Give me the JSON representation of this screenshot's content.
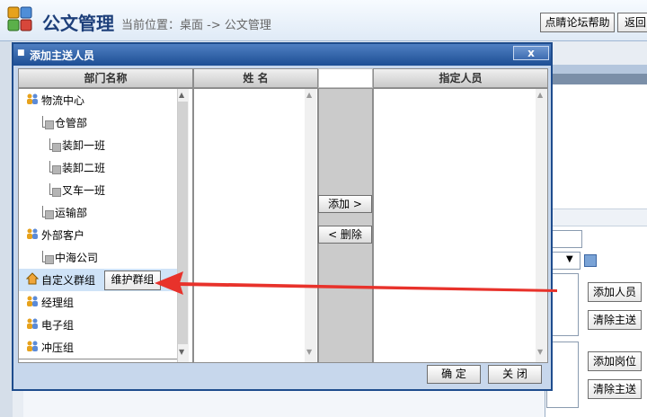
{
  "header": {
    "app_title": "公文管理",
    "breadcrumb": "当前位置：桌面 -> 公文管理",
    "forum_help_label": "点睛论坛帮助",
    "back_label": "返回"
  },
  "side_buttons": {
    "add_person": "添加人员",
    "clear_send_1": "清除主送",
    "add_position": "添加岗位",
    "clear_send_2": "清除主送"
  },
  "dialog": {
    "title": "添加主送人员",
    "close_label": "x",
    "columns": {
      "dept": "部门名称",
      "name": "姓  名",
      "assign": "指定人员"
    },
    "departments": [
      {
        "label": "物流中心",
        "icon": "people-icon",
        "indent": 0
      },
      {
        "label": "仓管部",
        "icon": "tree-node-icon",
        "indent": 1
      },
      {
        "label": "装卸一班",
        "icon": "tree-node-icon",
        "indent": 2
      },
      {
        "label": "装卸二班",
        "icon": "tree-node-icon",
        "indent": 2
      },
      {
        "label": "叉车一班",
        "icon": "tree-node-icon",
        "indent": 2
      },
      {
        "label": "运输部",
        "icon": "tree-node-icon",
        "indent": 1
      },
      {
        "label": "外部客户",
        "icon": "people-icon",
        "indent": 0
      },
      {
        "label": "中海公司",
        "icon": "tree-node-icon",
        "indent": 1
      },
      {
        "label": "自定义群组",
        "icon": "home-icon",
        "indent": 0,
        "selected": true
      },
      {
        "label": "经理组",
        "icon": "people-icon",
        "indent": 0
      },
      {
        "label": "电子组",
        "icon": "people-icon",
        "indent": 0
      },
      {
        "label": "冲压组",
        "icon": "people-icon",
        "indent": 0
      }
    ],
    "maintain_group_label": "维护群组",
    "add_label": "添加 >",
    "remove_label": "< 删除",
    "confirm_label": "确 定",
    "close_button_label": "关 闭"
  },
  "colors": {
    "dialog_title_bg": "#1d4e94",
    "dialog_body_bg": "#c7d7ec",
    "arrow": "#e8322b"
  }
}
